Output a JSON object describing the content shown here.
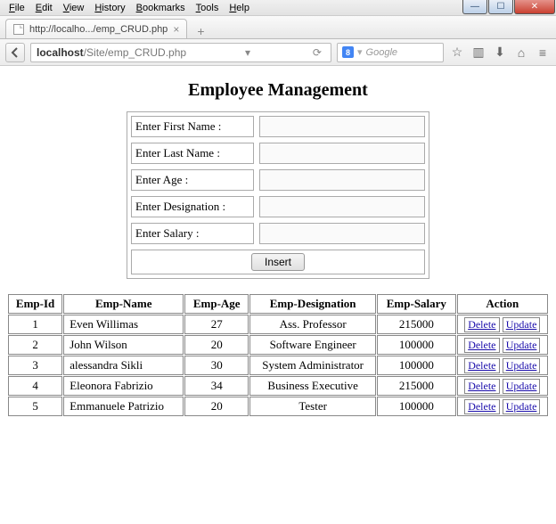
{
  "menu": [
    "File",
    "Edit",
    "View",
    "History",
    "Bookmarks",
    "Tools",
    "Help"
  ],
  "tab": {
    "title": "http://localho.../emp_CRUD.php"
  },
  "url": {
    "host": "localhost",
    "rest": "/Site/emp_CRUD.php"
  },
  "search": {
    "placeholder": "Google",
    "glyph": "8"
  },
  "page": {
    "title": "Employee Management",
    "labels": {
      "first": "Enter First Name :",
      "last": "Enter Last Name :",
      "age": "Enter Age :",
      "desig": "Enter Designation :",
      "salary": "Enter Salary :",
      "insert": "Insert"
    },
    "headers": [
      "Emp-Id",
      "Emp-Name",
      "Emp-Age",
      "Emp-Designation",
      "Emp-Salary",
      "Action"
    ],
    "actions": {
      "delete": "Delete",
      "update": "Update"
    },
    "rows": [
      {
        "id": "1",
        "name": "Even Willimas",
        "age": "27",
        "desig": "Ass. Professor",
        "salary": "215000"
      },
      {
        "id": "2",
        "name": "John Wilson",
        "age": "20",
        "desig": "Software Engineer",
        "salary": "100000"
      },
      {
        "id": "3",
        "name": "alessandra Sikli",
        "age": "30",
        "desig": "System Administrator",
        "salary": "100000"
      },
      {
        "id": "4",
        "name": "Eleonora Fabrizio",
        "age": "34",
        "desig": "Business Executive",
        "salary": "215000"
      },
      {
        "id": "5",
        "name": "Emmanuele Patrizio",
        "age": "20",
        "desig": "Tester",
        "salary": "100000"
      }
    ]
  }
}
